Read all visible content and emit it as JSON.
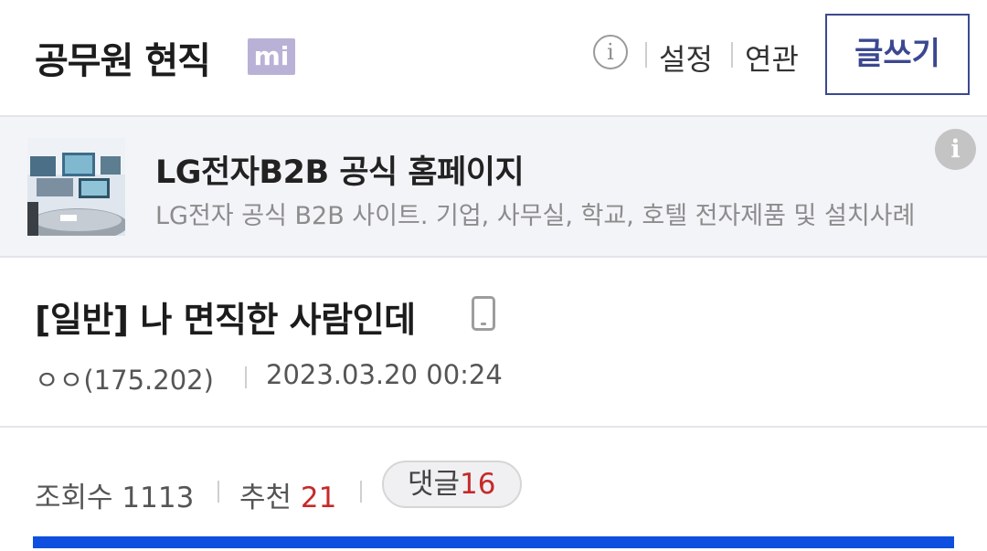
{
  "header": {
    "gallery_title": "공무원 현직",
    "badge": "mi",
    "info_icon": "i",
    "settings_label": "설정",
    "related_label": "연관",
    "write_label": "글쓰기"
  },
  "ad": {
    "title": "LG전자B2B 공식 홈페이지",
    "description": "LG전자 공식 B2B 사이트. 기업, 사무실, 학교, 호텔 전자제품 및 설치사례",
    "info_icon": "i",
    "thumbnail": "conference-room-image"
  },
  "post": {
    "title": "[일반] 나 면직한 사람인데",
    "author": "ㅇㅇ(175.202)",
    "datetime": "2023.03.20 00:24",
    "device_icon": "mobile-icon"
  },
  "stats": {
    "views_label": "조회수",
    "views": "1113",
    "recommend_label": "추천",
    "recommend": "21",
    "comments_label": "댓글",
    "comments": "16"
  },
  "colors": {
    "accent": "#3b4890",
    "badge": "#b9b2d6",
    "count_red": "#c62a2a",
    "bar_blue": "#0f4fe0"
  }
}
